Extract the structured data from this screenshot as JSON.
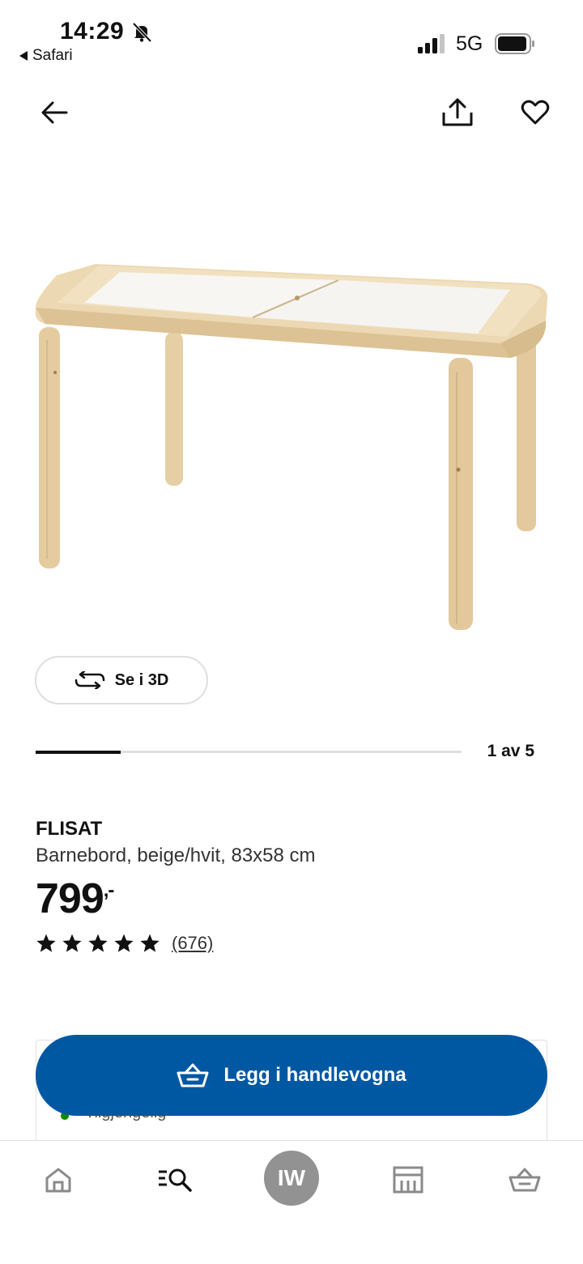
{
  "status_bar": {
    "time": "14:29",
    "back_app": "Safari",
    "network": "5G"
  },
  "header": {
    "back_icon": "arrow-left-icon",
    "share_icon": "share-icon",
    "favorite_icon": "heart-icon"
  },
  "gallery": {
    "view_3d_label": "Se i 3D",
    "position_label": "1 av 5",
    "current": 1,
    "total": 5
  },
  "product": {
    "name": "FLISAT",
    "description": "Barnebord, beige/hvit, 83x58 cm",
    "price": "799",
    "price_suffix": ",-",
    "rating": 5,
    "review_count": "(676)"
  },
  "availability": {
    "text": "Tilgjengelig"
  },
  "cta": {
    "label": "Legg i handlevogna",
    "color": "#0058a3"
  },
  "bottom_nav": {
    "items": [
      {
        "icon": "home-icon"
      },
      {
        "icon": "search-icon"
      },
      {
        "label": "IW"
      },
      {
        "icon": "store-icon"
      },
      {
        "icon": "cart-icon"
      }
    ]
  }
}
